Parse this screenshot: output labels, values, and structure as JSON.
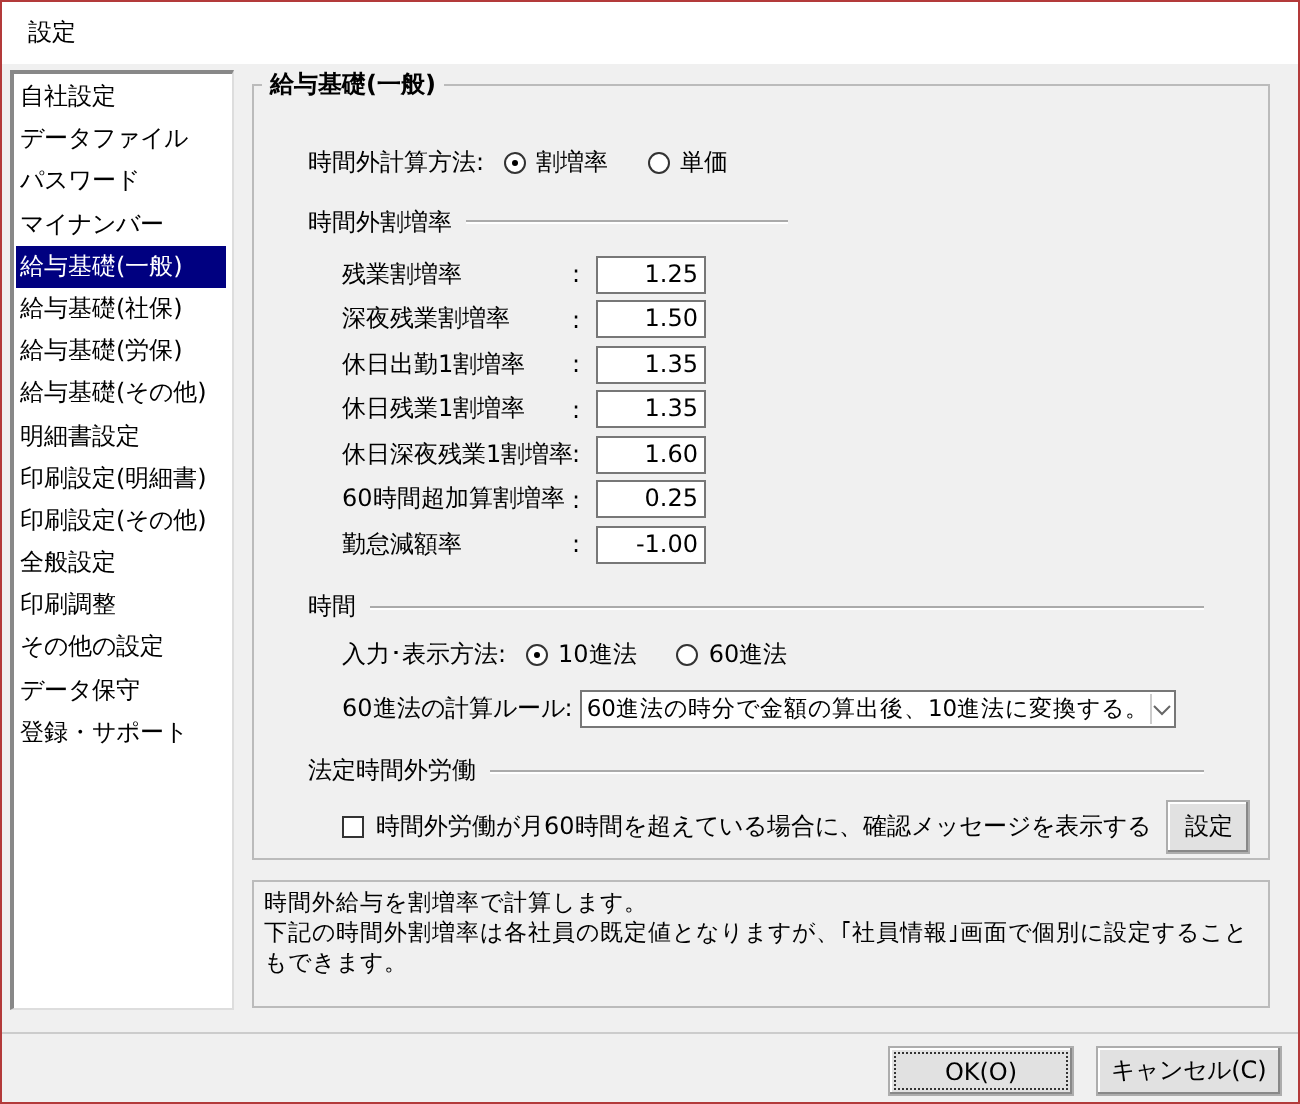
{
  "window": {
    "title": "設定"
  },
  "sidebar": {
    "items": [
      {
        "label": "自社設定",
        "selected": false
      },
      {
        "label": "データファイル",
        "selected": false
      },
      {
        "label": "パスワード",
        "selected": false
      },
      {
        "label": "マイナンバー",
        "selected": false
      },
      {
        "label": "給与基礎(一般)",
        "selected": true
      },
      {
        "label": "給与基礎(社保)",
        "selected": false
      },
      {
        "label": "給与基礎(労保)",
        "selected": false
      },
      {
        "label": "給与基礎(その他)",
        "selected": false
      },
      {
        "label": "明細書設定",
        "selected": false
      },
      {
        "label": "印刷設定(明細書)",
        "selected": false
      },
      {
        "label": "印刷設定(その他)",
        "selected": false
      },
      {
        "label": "全般設定",
        "selected": false
      },
      {
        "label": "印刷調整",
        "selected": false
      },
      {
        "label": "その他の設定",
        "selected": false
      },
      {
        "label": "データ保守",
        "selected": false
      },
      {
        "label": "登録・サポート",
        "selected": false
      }
    ]
  },
  "section": {
    "title": "給与基礎(一般)",
    "overtime_method": {
      "label": "時間外計算方法:",
      "options": [
        {
          "label": "割増率",
          "selected": true
        },
        {
          "label": "単価",
          "selected": false
        }
      ]
    },
    "rates": {
      "title": "時間外割増率",
      "rows": [
        {
          "label": "残業割増率",
          "colon": ":",
          "value": "1.25"
        },
        {
          "label": "深夜残業割増率",
          "colon": ":",
          "value": "1.50"
        },
        {
          "label": "休日出勤1割増率",
          "colon": ":",
          "value": "1.35"
        },
        {
          "label": "休日残業1割増率",
          "colon": ":",
          "value": "1.35"
        },
        {
          "label": "休日深夜残業1割増率",
          "colon": ":",
          "value": "1.60"
        },
        {
          "label": "60時間超加算割増率",
          "colon": ":",
          "value": "0.25"
        },
        {
          "label": "勤怠減額率",
          "colon": ":",
          "value": "-1.00"
        }
      ]
    },
    "time": {
      "title": "時間",
      "input_method": {
        "label": "入力･表示方法:",
        "options": [
          {
            "label": "10進法",
            "selected": true
          },
          {
            "label": "60進法",
            "selected": false
          }
        ]
      },
      "rule": {
        "label": "60進法の計算ルール:",
        "value": "60進法の時分で金額の算出後、10進法に変換する。"
      }
    },
    "legal": {
      "title": "法定時間外労働",
      "checkbox": {
        "label": "時間外労働が月60時間を超えている場合に、確認メッセージを表示する",
        "checked": false
      },
      "button": "設定"
    }
  },
  "description": {
    "lines": [
      "時間外給与を割増率で計算します。",
      "下記の時間外割増率は各社員の既定値となりますが、｢社員情報｣画面で個別に設定することもできます。"
    ]
  },
  "buttons": [
    {
      "label": "OK(O)",
      "default": true
    },
    {
      "label": "キャンセル(C)",
      "default": false
    }
  ]
}
